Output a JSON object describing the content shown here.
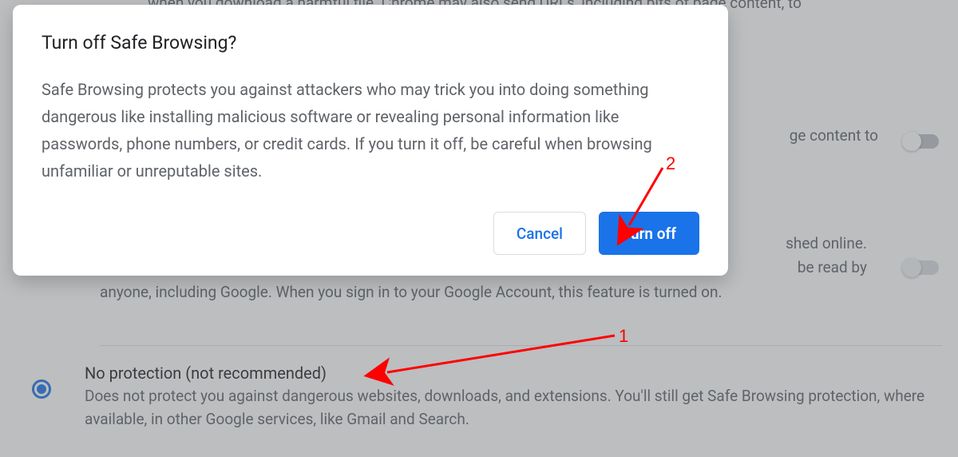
{
  "background": {
    "top_fragment": "when you download a harmful file. Chrome may also send URLs, including bits of page content, to",
    "block1_fragment": "ge content to",
    "block2_line1": "shed online.",
    "block2_line2": "be read by",
    "block2_line3": "anyone, including Google. When you sign in to your Google Account, this feature is turned on.",
    "option": {
      "title": "No protection (not recommended)",
      "desc": "Does not protect you against dangerous websites, downloads, and extensions. You'll still get Safe Browsing protection, where available, in other Google services, like Gmail and Search."
    }
  },
  "dialog": {
    "title": "Turn off Safe Browsing?",
    "body": "Safe Browsing protects you against attackers who may trick you into doing something dangerous like installing malicious software or revealing personal information like passwords, phone numbers, or credit cards. If you turn it off, be careful when browsing unfamiliar or unreputable sites.",
    "cancel_label": "Cancel",
    "confirm_label": "Turn off"
  },
  "annotations": {
    "label1": "1",
    "label2": "2"
  }
}
